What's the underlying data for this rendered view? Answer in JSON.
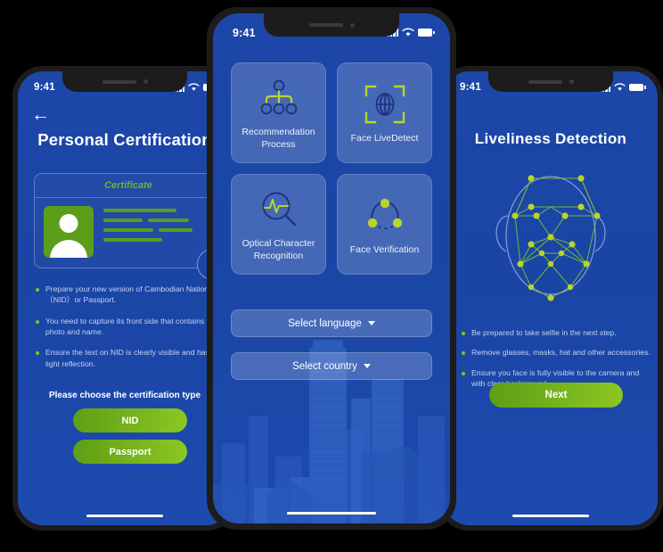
{
  "status_bar": {
    "time": "9:41",
    "signal_icon": "signal-bars-icon",
    "wifi_icon": "wifi-icon",
    "battery_icon": "battery-icon"
  },
  "colors": {
    "background": "#000000",
    "bezel": "#1c1c1c",
    "screen_blue": "#1b46a5",
    "accent_green": "#8cc722",
    "accent_green_dark": "#5f9e16",
    "card_translucent": "rgba(255,255,255,0.19)",
    "body_text": "#c6d3ef"
  },
  "left_screen": {
    "back_icon": "back-arrow-icon",
    "title": "Personal Certification",
    "certificate_card": {
      "title": "Certificate",
      "photo_icon": "person-avatar-icon",
      "check_icon": "check-circle-icon"
    },
    "bullets": [
      "Prepare your new version of Cambodian National ID（NID）or Passport.",
      "You need to capture its front side that contains your photo and name.",
      "Ensure the text on NID is clearly visible and has no light reflection."
    ],
    "choose_label": "Please choose the certification type",
    "buttons": [
      {
        "label": "NID",
        "name": "nid-button"
      },
      {
        "label": "Passport",
        "name": "passport-button"
      }
    ]
  },
  "middle_screen": {
    "cards": [
      {
        "label": "Recommendation Process",
        "icon": "org-chart-icon"
      },
      {
        "label": "Face LiveDetect",
        "icon": "face-scan-frame-icon"
      },
      {
        "label": "Optical Character Recognition",
        "icon": "magnifier-waveform-icon"
      },
      {
        "label": "Face Verification",
        "icon": "three-node-share-icon"
      }
    ],
    "selects": [
      {
        "label": "Select language",
        "name": "select-language-dropdown"
      },
      {
        "label": "Select country",
        "name": "select-country-dropdown"
      }
    ],
    "background_art": "city-skyline-watermark"
  },
  "right_screen": {
    "title": "Liveliness  Detection",
    "face_mesh_icon": "face-mesh-icon",
    "bullets": [
      "Be prepared to take selfie in the next step.",
      "Remove glasses, masks, hat and other accessories.",
      "Ensure you face is fully visible to the camera and with clear background."
    ],
    "next_button": "Next"
  }
}
